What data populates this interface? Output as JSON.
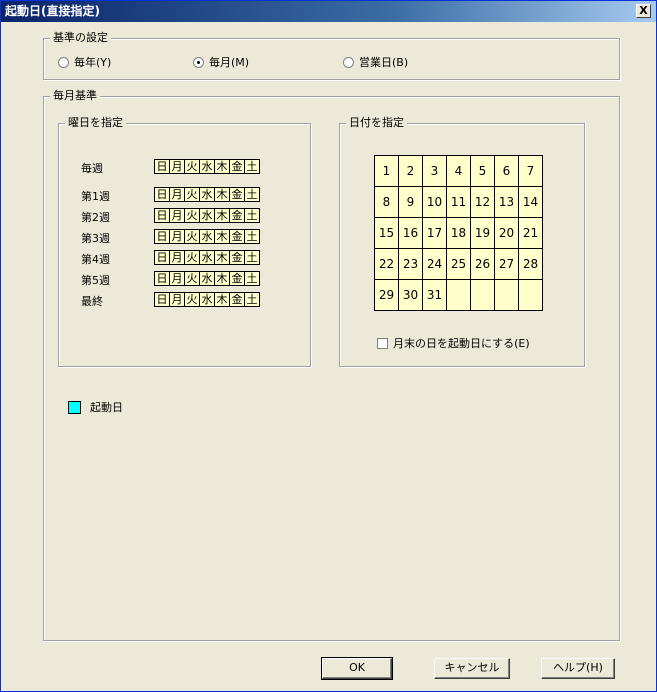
{
  "window": {
    "title": "起動日(直接指定)",
    "close_label": "X"
  },
  "basis": {
    "title": "基準の設定",
    "options": [
      {
        "label": "毎年(Y)",
        "checked": false
      },
      {
        "label": "毎月(M)",
        "checked": true
      },
      {
        "label": "営業日(B)",
        "checked": false
      }
    ]
  },
  "monthly": {
    "title": "毎月基準",
    "weekday_group": {
      "title": "曜日を指定",
      "rows": [
        "毎週",
        "第1週",
        "第2週",
        "第3週",
        "第4週",
        "第5週",
        "最終"
      ],
      "days": [
        "日",
        "月",
        "火",
        "水",
        "木",
        "金",
        "土"
      ]
    },
    "date_group": {
      "title": "日付を指定",
      "dates": [
        "1",
        "2",
        "3",
        "4",
        "5",
        "6",
        "7",
        "8",
        "9",
        "10",
        "11",
        "12",
        "13",
        "14",
        "15",
        "16",
        "17",
        "18",
        "19",
        "20",
        "21",
        "22",
        "23",
        "24",
        "25",
        "26",
        "27",
        "28",
        "29",
        "30",
        "31",
        "",
        "",
        "",
        ""
      ],
      "month_end_label": "月末の日を起動日にする(E)"
    },
    "legend_label": "起動日",
    "legend_color": "#00ffff"
  },
  "buttons": {
    "ok": "OK",
    "cancel": "キャンセル",
    "help": "ヘルプ(H)"
  }
}
